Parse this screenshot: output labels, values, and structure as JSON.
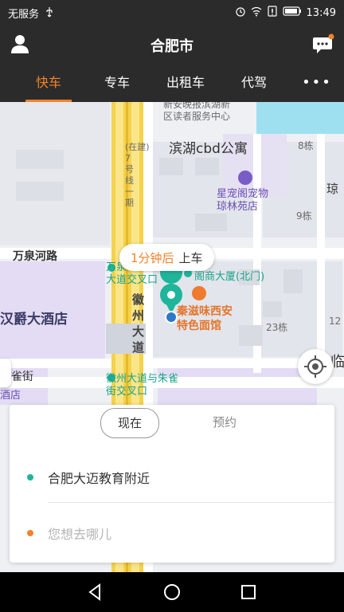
{
  "status_bar": {
    "carrier": "无服务",
    "time": "13:49"
  },
  "header": {
    "title": "合肥市"
  },
  "tabs": [
    {
      "label": "快车",
      "active": true
    },
    {
      "label": "专车"
    },
    {
      "label": "出租车"
    },
    {
      "label": "代驾"
    },
    {
      "label": "•••"
    }
  ],
  "map": {
    "labels": {
      "reader_service": "新安晚报滨湖新\n区读者服务中心",
      "binhu_cbd": "滨湖cbd公寓",
      "bldg8": "8栋",
      "bldg9": "9栋",
      "bldg23": "23栋",
      "bldg12": "12",
      "jun": "琼",
      "lin": "临",
      "pet_shop": "星宠阁宠物\n琼林苑店",
      "wanquan_rd": "万泉河路",
      "hanjue_hotel": "汉爵大酒店",
      "intersection_top": "万泉河路\n大道交叉口",
      "mall_north": "阁商大厦(北门)",
      "noodle_shop": "秦滋味西安\n特色面馆",
      "huizhou_ave": "徽\n州\n大\n道",
      "intersection_bottom": "徽州大道与朱雀\n街交叉口",
      "zhuque_st": "朱雀街",
      "hotel_cut": "酒店",
      "road_text": "(在建)\n7\n号\n线\n一\n期"
    },
    "pickup_eta": "1分钟后",
    "pickup_label": "上车"
  },
  "booking": {
    "mode_now": "现在",
    "mode_reserve": "预约",
    "from": "合肥大迈教育附近",
    "to_placeholder": "您想去哪儿"
  },
  "colors": {
    "accent": "#f4822b",
    "origin_dot": "#1fb59b",
    "dest_dot": "#f4822b",
    "bar_bg": "#2b2b2b",
    "road_yellow": "#f5d24b"
  }
}
